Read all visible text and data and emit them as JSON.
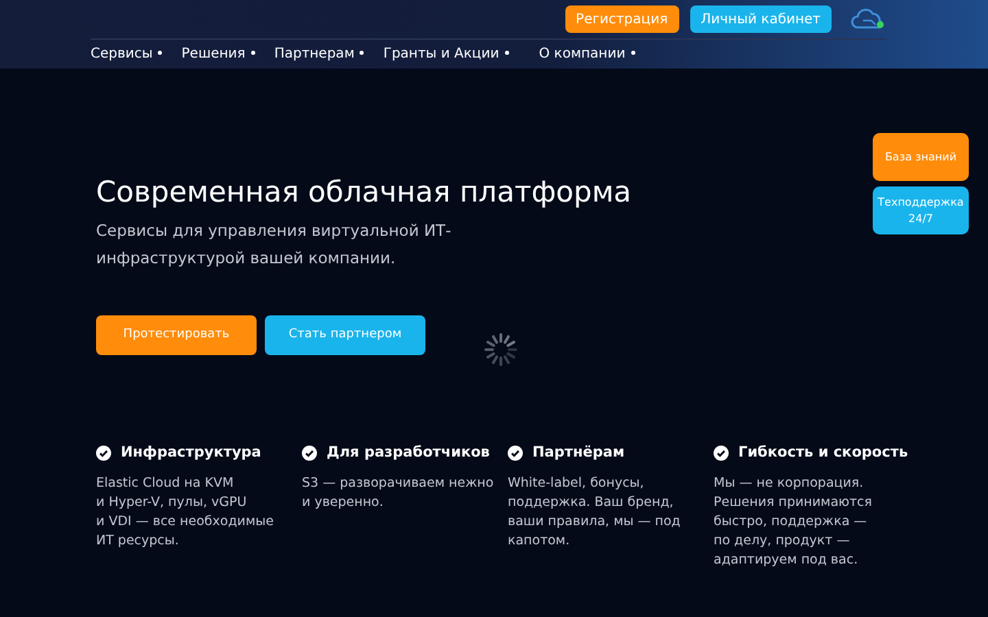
{
  "header": {
    "buttons": [
      {
        "label": "Регистрация",
        "kind": "orange"
      },
      {
        "label": "Личный кабинет",
        "kind": "blue"
      }
    ],
    "nav": [
      "Сервисы",
      "Решения",
      "Партнерам",
      "Гранты и Акции",
      "О компании"
    ]
  },
  "side_buttons": [
    {
      "label": "База знаний",
      "kind": "orange"
    },
    {
      "label": "Техподдержка 24/7",
      "kind": "blue"
    }
  ],
  "hero": {
    "title": "Современная облачная платформа",
    "subtitle": "Сервисы для управления виртуальной ИТ-инфраструктурой вашей компании.",
    "buttons": [
      {
        "label": "Протестировать",
        "kind": "orange"
      },
      {
        "label": "Стать партнером",
        "kind": "blue"
      }
    ]
  },
  "features": [
    {
      "title": "Инфраструктура",
      "text": "Elastic Cloud на KVM\nи Hyper-V, пулы, vGPU\nи VDI — все необходимые\nИТ ресурсы."
    },
    {
      "title": "Для разработчиков",
      "text": "S3 — разворачиваем нежно\nи уверенно."
    },
    {
      "title": "Партнёрам",
      "text": "White-label, бонусы,\nподдержка. Ваш бренд,\nваши правила, мы — под\nкапотом."
    },
    {
      "title": "Гибкость и скорость",
      "text": "Мы — не корпорация.\nРешения принимаются\nбыстро, поддержка —\nпо делу, продукт —\nадаптируем под вас."
    }
  ]
}
